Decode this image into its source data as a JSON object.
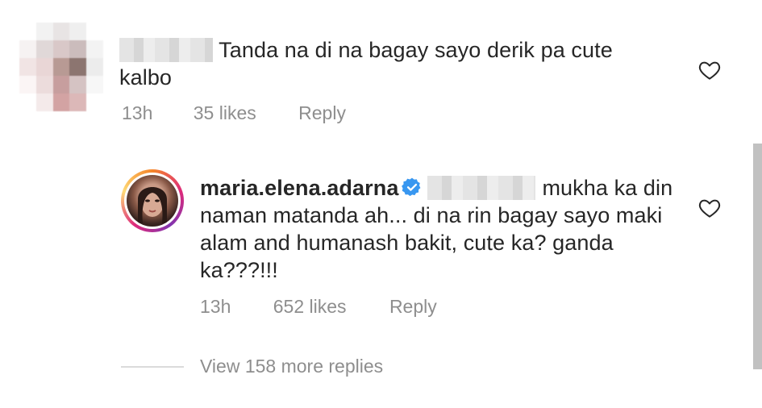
{
  "comment1": {
    "text": "Tanda na di na bagay sayo derik pa cute kalbo",
    "time": "13h",
    "likes": "35 likes",
    "reply_label": "Reply"
  },
  "comment2": {
    "username": "maria.elena.adarna",
    "text_line1": "mukha ka",
    "text_rest": "din naman matanda ah... di na rin bagay sayo maki alam and humanash bakit, cute ka? ganda ka???!!!",
    "time": "13h",
    "likes": "652 likes",
    "reply_label": "Reply"
  },
  "view_more": "View 158 more replies",
  "colors": {
    "text": "#262626",
    "secondary": "#8e8e8e",
    "verified": "#3897f0",
    "divider": "#dbdbdb"
  },
  "icons": {
    "like": "heart-outline-icon",
    "verified": "verified-badge-icon"
  }
}
